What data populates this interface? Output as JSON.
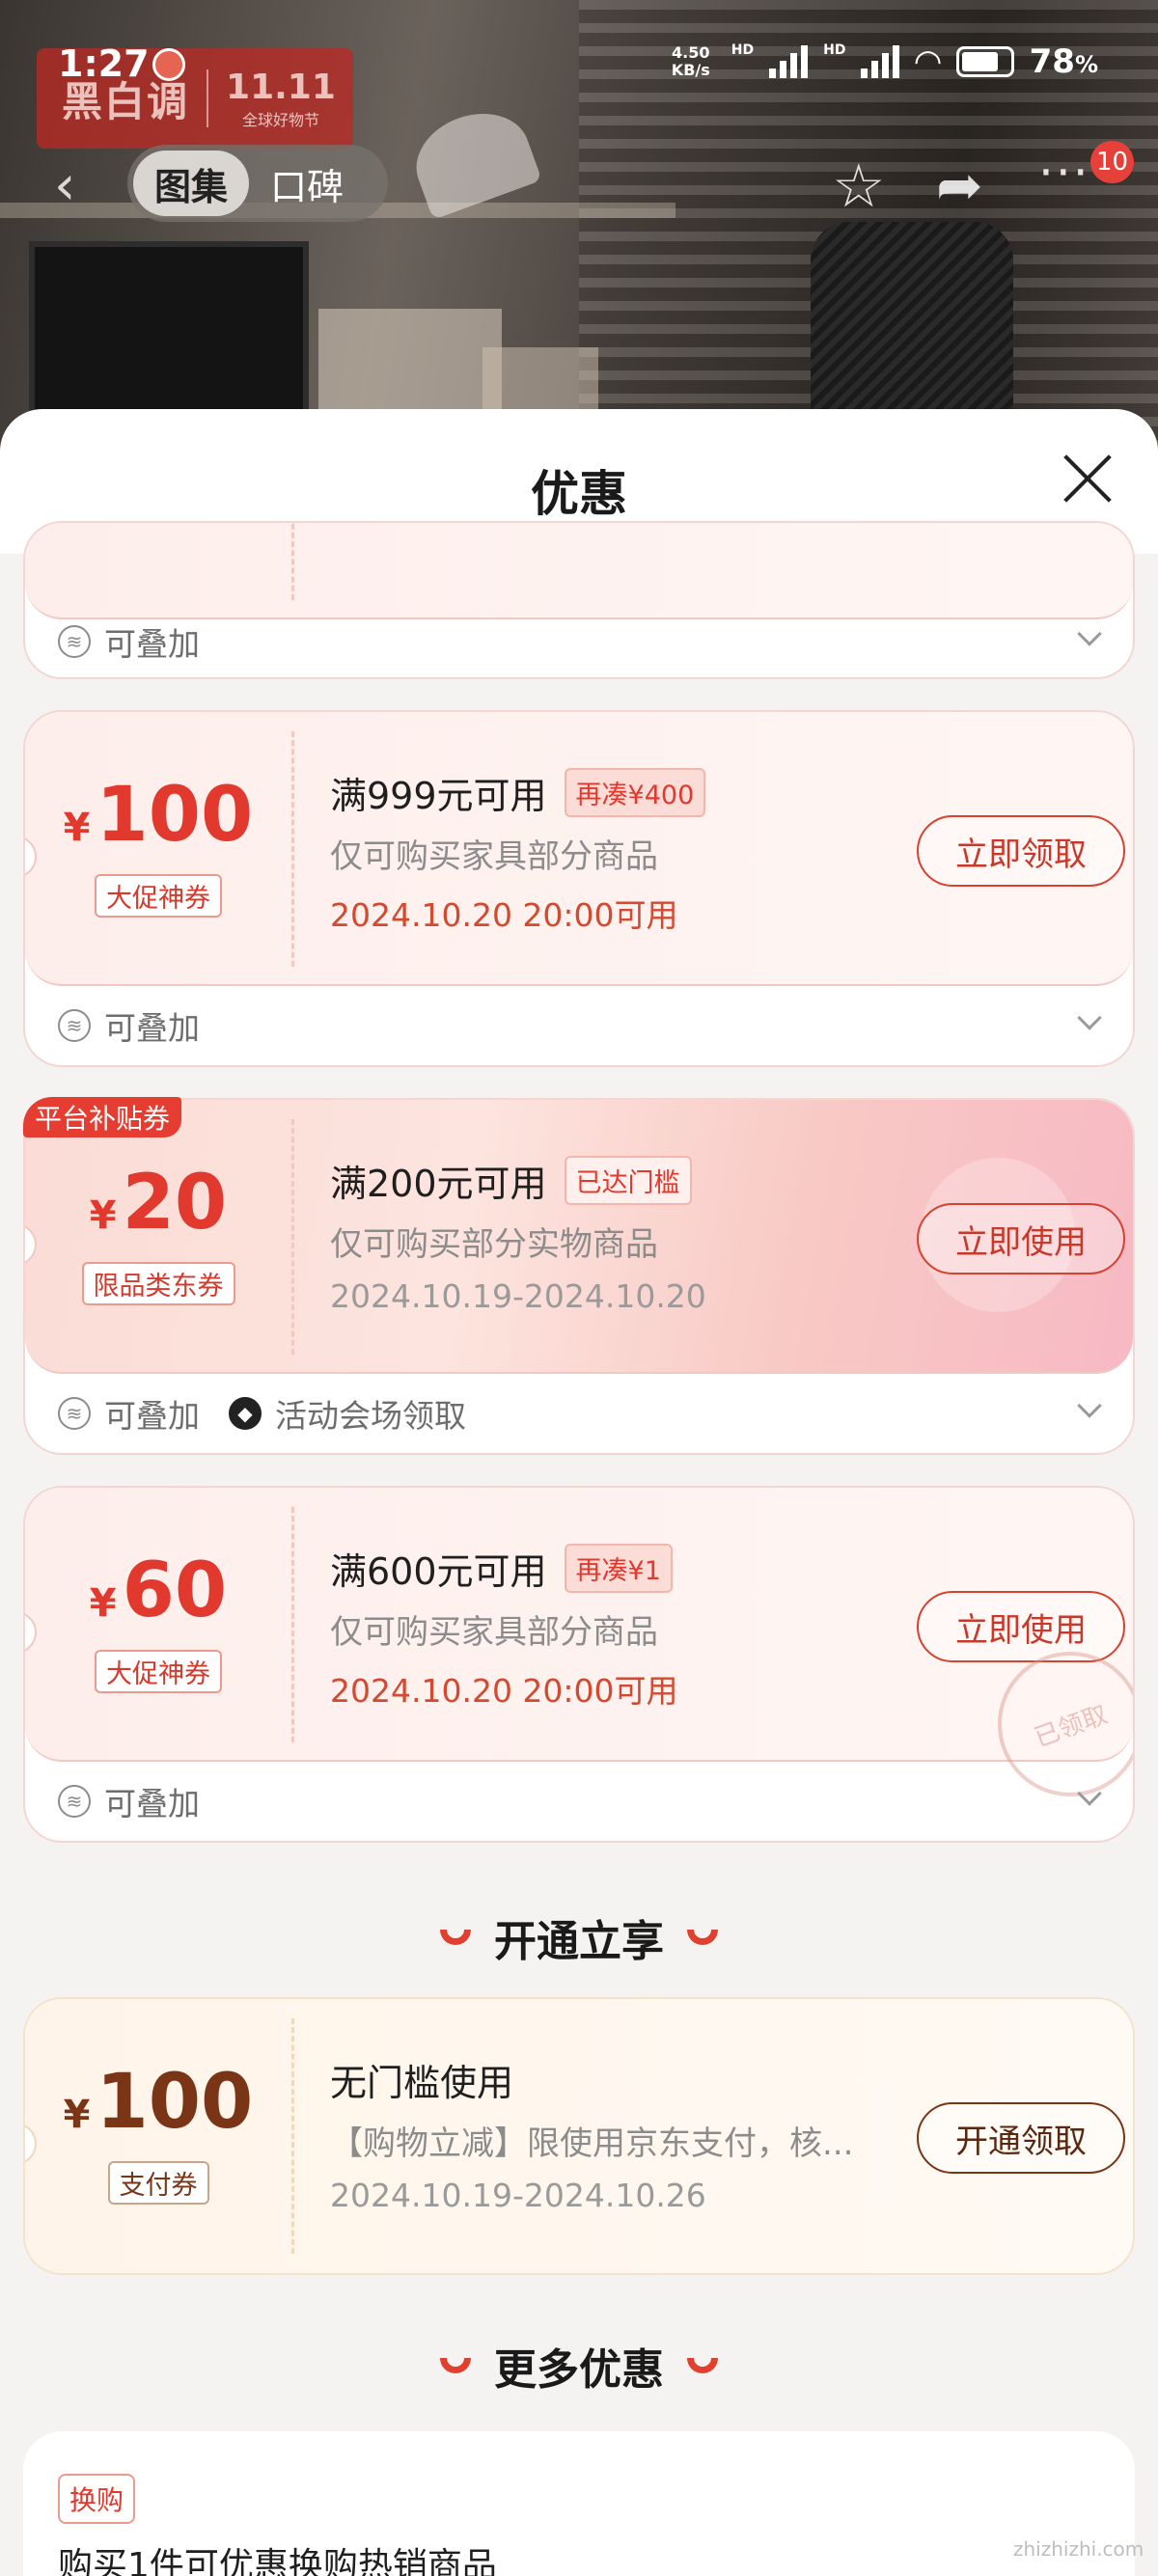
{
  "status_bar": {
    "time": "1:27",
    "net_speed": "4.50 KB/s",
    "hd": "HD",
    "battery": "78",
    "battery_unit": "%"
  },
  "brand": {
    "name": "黑白调",
    "event": "11.11",
    "event_sub": "全球好物节"
  },
  "nav": {
    "tabs": [
      "图集",
      "口碑"
    ],
    "active_tab": 0,
    "badge_count": "10",
    "back_glyph": "‹",
    "more_glyph": "···"
  },
  "sheet": {
    "title": "优惠"
  },
  "partial_card": {
    "footer_items": [
      "可叠加"
    ]
  },
  "coupons": [
    {
      "yen": "¥",
      "amount": "100",
      "tag": "大促神券",
      "title": "满999元可用",
      "pill": "再凑¥400",
      "desc": "仅可购买家具部分商品",
      "date": "2024.10.20 20:00可用",
      "button": "立即领取",
      "footer_items": [
        "可叠加"
      ]
    },
    {
      "yen": "¥",
      "amount": "20",
      "tag": "限品类东券",
      "corner_tag": "平台补贴券",
      "title": "满200元可用",
      "pill": "已达门槛",
      "desc": "仅可购买部分实物商品",
      "date": "2024.10.19-2024.10.20",
      "button": "立即使用",
      "footer_items": [
        "可叠加",
        "活动会场领取"
      ]
    },
    {
      "yen": "¥",
      "amount": "60",
      "tag": "大促神券",
      "title": "满600元可用",
      "pill": "再凑¥1",
      "desc": "仅可购买家具部分商品",
      "date": "2024.10.20 20:00可用",
      "button": "立即使用",
      "stamp": "已领取",
      "footer_items": [
        "可叠加"
      ]
    }
  ],
  "section_open": {
    "title": "开通立享"
  },
  "pay_coupon": {
    "yen": "¥",
    "amount": "100",
    "tag": "支付券",
    "title": "无门槛使用",
    "desc": "【购物立减】限使用京东支付，核...",
    "date": "2024.10.19-2024.10.26",
    "button": "开通领取"
  },
  "section_more": {
    "title": "更多优惠"
  },
  "more_offer": {
    "tag": "换购",
    "text": "购买1件可优惠换购热销商品"
  },
  "watermark": "zhizhizhi.com",
  "colors": {
    "accent_red": "#e2392f",
    "pay_brown": "#7a3416"
  },
  "icons": {
    "stack": "stack-icon",
    "venue": "venue-icon",
    "close": "close-icon",
    "star": "star-icon",
    "share": "share-icon"
  }
}
